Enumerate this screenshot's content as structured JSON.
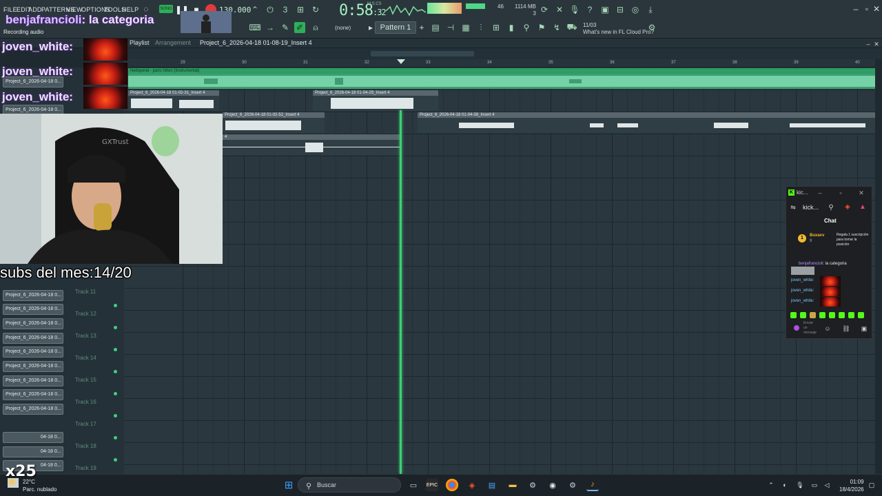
{
  "menu": [
    "FILE",
    "EDIT",
    "ADD",
    "PATTERNS",
    "VIEW",
    "OPTIONS",
    "TOOLS",
    "HELP"
  ],
  "transport": {
    "tempo": "130.000",
    "time_main": "0:58",
    "time_sub": ":32",
    "time_unit": "M:S:CS",
    "pattern": "Pattern 1",
    "none_label": "(none)"
  },
  "resources": {
    "cpu_value": "46",
    "memory": "1114 MB",
    "memory_sub": "3"
  },
  "news": {
    "date": "11/03",
    "text": "What's new in FL Cloud Pro?"
  },
  "playlist": {
    "title": "Playlist",
    "subtitle": "Arrangement",
    "project": "Project_6_2026-04-18 01-08-19_Insert 4",
    "ruler": [
      "29",
      "30",
      "31",
      "32",
      "33",
      "34",
      "35",
      "36",
      "37",
      "38",
      "39",
      "40"
    ],
    "clips": [
      {
        "label": "Nettspend - paris hilton (Instrumental)"
      },
      {
        "label": "Project_6_2026-04-18 01-02-31_Insert 4"
      },
      {
        "label": "Project_6_2026-04-18 01-04-29_Insert 4"
      },
      {
        "label": "Project_6_2026-04-18 01-02-52_Insert 4"
      },
      {
        "label": "Project_6_2026-04-18 01-04-38_Insert 4"
      },
      {
        "label": "4"
      }
    ]
  },
  "tracklist": {
    "buttons": [
      "Project_6_2026-04-18 0...",
      "Project_6_2026-04-18 0...",
      "Project_6_2026-04-18 0...",
      "Project_6_2026-04-18 0...",
      "Project_6_2026-04-18 0...",
      "Project_6_2026-04-18 0...",
      "Project_6_2026-04-18 0...",
      "Project_6_2026-04-18 0...",
      "Project_6_2026-04-18 0...",
      "Project_6_2026-04-18 0...",
      "Project_6_2026-04-18 0..."
    ],
    "bottom_buttons": [
      "04-18 0...",
      "04-18 0...",
      "04-18 0..."
    ],
    "tracks": [
      "Track 11",
      "Track 12",
      "Track 13",
      "Track 14",
      "Track 15",
      "Track 16",
      "Track 17",
      "Track 18",
      "Track 19"
    ]
  },
  "overlay": {
    "streamer": "benjafrancioli",
    "streamer_msg": ": la categoria",
    "recording": "Recording audio",
    "chatters": [
      "joven_white:",
      "joven_white:",
      "joven_white:"
    ],
    "subs": "subs del mes:14/20",
    "multiplier": "x25"
  },
  "kick_window": {
    "title": "kic...",
    "url": "kick...",
    "chat_title": "Chat",
    "gift_user": "Buxavv",
    "gift_count": "9",
    "gift_text": "Regala 1 suscripción para tomar la posición",
    "msg_user": "benjafrancioli",
    "msg_text": ": la categoria",
    "chatters": [
      "joven_white:",
      "joven_white:",
      "joven_white:"
    ],
    "send_placeholder": "Enviar un mensaje"
  },
  "taskbar": {
    "search": "Buscar",
    "weather_temp": "22°C",
    "weather_desc": "Parc. nublado",
    "time": "01:09",
    "date": "18/4/2026"
  }
}
